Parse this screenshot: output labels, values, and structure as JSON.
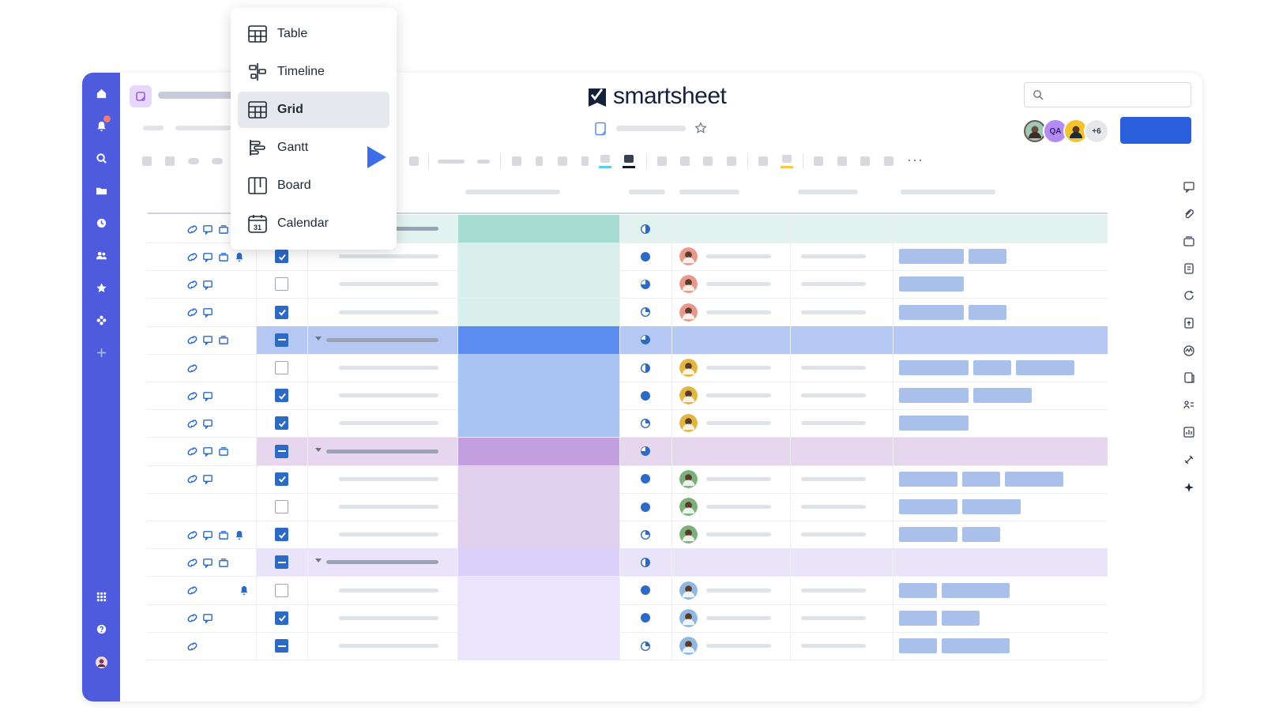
{
  "brand": {
    "name": "smartsheet",
    "accent": "#2b5fdc",
    "rail_color": "#4d5bdc"
  },
  "search": {
    "placeholder": ""
  },
  "collaborators": {
    "overflow_label": "+6",
    "initials": "QA"
  },
  "view_menu": {
    "items": [
      {
        "label": "Table",
        "icon": "table-icon",
        "selected": false
      },
      {
        "label": "Timeline",
        "icon": "timeline-icon",
        "selected": false
      },
      {
        "label": "Grid",
        "icon": "grid-icon",
        "selected": true
      },
      {
        "label": "Gantt",
        "icon": "gantt-icon",
        "selected": false
      },
      {
        "label": "Board",
        "icon": "board-icon",
        "selected": false
      },
      {
        "label": "Calendar",
        "icon": "calendar-icon",
        "selected": false,
        "badge": "31"
      }
    ]
  },
  "left_rail": {
    "icons": [
      "home-icon",
      "notifications-icon",
      "search-icon",
      "folder-icon",
      "recents-icon",
      "contacts-icon",
      "favorites-icon",
      "solutions-icon",
      "add-icon"
    ],
    "bottom_icons": [
      "apps-icon",
      "help-icon",
      "account-avatar"
    ]
  },
  "right_rail": {
    "icons": [
      "comments-icon",
      "attachments-icon",
      "proofing-icon",
      "summary-icon",
      "activity-icon",
      "publish-icon",
      "automation-icon",
      "forms-icon",
      "connections-icon",
      "reports-icon",
      "integrations-icon",
      "ai-assistant-icon"
    ]
  },
  "grid": {
    "groups": [
      {
        "row_color": "#e2f2ef",
        "swatch": "#a6dbd2",
        "child_swatch": "#d9efeb"
      },
      {
        "row_color": "#b5c8f4",
        "swatch": "#5b8cf0",
        "child_swatch": "#a9c4f3"
      },
      {
        "row_color": "#e6d7ef",
        "swatch": "#c49fdf",
        "child_swatch": "#e2d1ee"
      },
      {
        "row_color": "#e9e4f8",
        "swatch": "#dbd0fa",
        "child_swatch": "#ebe5fb"
      }
    ],
    "rows": [
      {
        "type": "header",
        "group": 0,
        "icons": [
          "link",
          "comment",
          "proof"
        ],
        "check": "none",
        "status": "half",
        "person": null,
        "tags": []
      },
      {
        "type": "child",
        "group": 0,
        "icons": [
          "link",
          "comment",
          "proof",
          "bell"
        ],
        "check": "checked",
        "status": "full",
        "person": "#e79a8b",
        "tags": [
          82,
          48
        ]
      },
      {
        "type": "child",
        "group": 0,
        "icons": [
          "link",
          "comment"
        ],
        "check": "unchecked",
        "status": "three-quarter",
        "person": "#e79a8b",
        "tags": [
          82
        ]
      },
      {
        "type": "child",
        "group": 0,
        "icons": [
          "link",
          "comment"
        ],
        "check": "checked",
        "status": "quarter",
        "person": "#e79a8b",
        "tags": [
          82,
          48
        ]
      },
      {
        "type": "header",
        "group": 1,
        "icons": [
          "link",
          "comment",
          "proof"
        ],
        "check": "partial",
        "status": "three-quarter",
        "person": null,
        "tags": []
      },
      {
        "type": "child",
        "group": 1,
        "icons": [
          "link"
        ],
        "check": "unchecked",
        "status": "half",
        "person": "#e2b640",
        "tags": [
          88,
          48,
          74
        ]
      },
      {
        "type": "child",
        "group": 1,
        "icons": [
          "link",
          "comment"
        ],
        "check": "checked",
        "status": "full",
        "person": "#e2b640",
        "tags": [
          88,
          74
        ]
      },
      {
        "type": "child",
        "group": 1,
        "icons": [
          "link",
          "comment"
        ],
        "check": "checked",
        "status": "quarter",
        "person": "#e2b640",
        "tags": [
          88
        ]
      },
      {
        "type": "header",
        "group": 2,
        "icons": [
          "link",
          "comment",
          "proof"
        ],
        "check": "partial",
        "status": "three-quarter",
        "person": null,
        "tags": []
      },
      {
        "type": "child",
        "group": 2,
        "icons": [
          "link",
          "comment"
        ],
        "check": "checked",
        "status": "full",
        "person": "#7cb07a",
        "tags": [
          74,
          48,
          74
        ]
      },
      {
        "type": "child",
        "group": 2,
        "icons": [],
        "check": "unchecked",
        "status": "full",
        "person": "#7cb07a",
        "tags": [
          74,
          74
        ]
      },
      {
        "type": "child",
        "group": 2,
        "icons": [
          "link",
          "comment",
          "proof",
          "bell"
        ],
        "check": "checked",
        "status": "quarter",
        "person": "#7cb07a",
        "tags": [
          74,
          48
        ]
      },
      {
        "type": "header",
        "group": 3,
        "icons": [
          "link",
          "comment",
          "proof"
        ],
        "check": "partial",
        "status": "half",
        "person": null,
        "tags": []
      },
      {
        "type": "child",
        "group": 3,
        "icons": [
          "link",
          "bell"
        ],
        "check": "unchecked",
        "status": "full",
        "person": "#8fb7df",
        "tags": [
          48,
          86
        ]
      },
      {
        "type": "child",
        "group": 3,
        "icons": [
          "link",
          "comment"
        ],
        "check": "checked",
        "status": "full",
        "person": "#8fb7df",
        "tags": [
          48,
          48
        ]
      },
      {
        "type": "child",
        "group": 3,
        "icons": [
          "link"
        ],
        "check": "partial",
        "status": "quarter",
        "person": "#8fb7df",
        "tags": [
          48,
          86
        ]
      }
    ]
  }
}
